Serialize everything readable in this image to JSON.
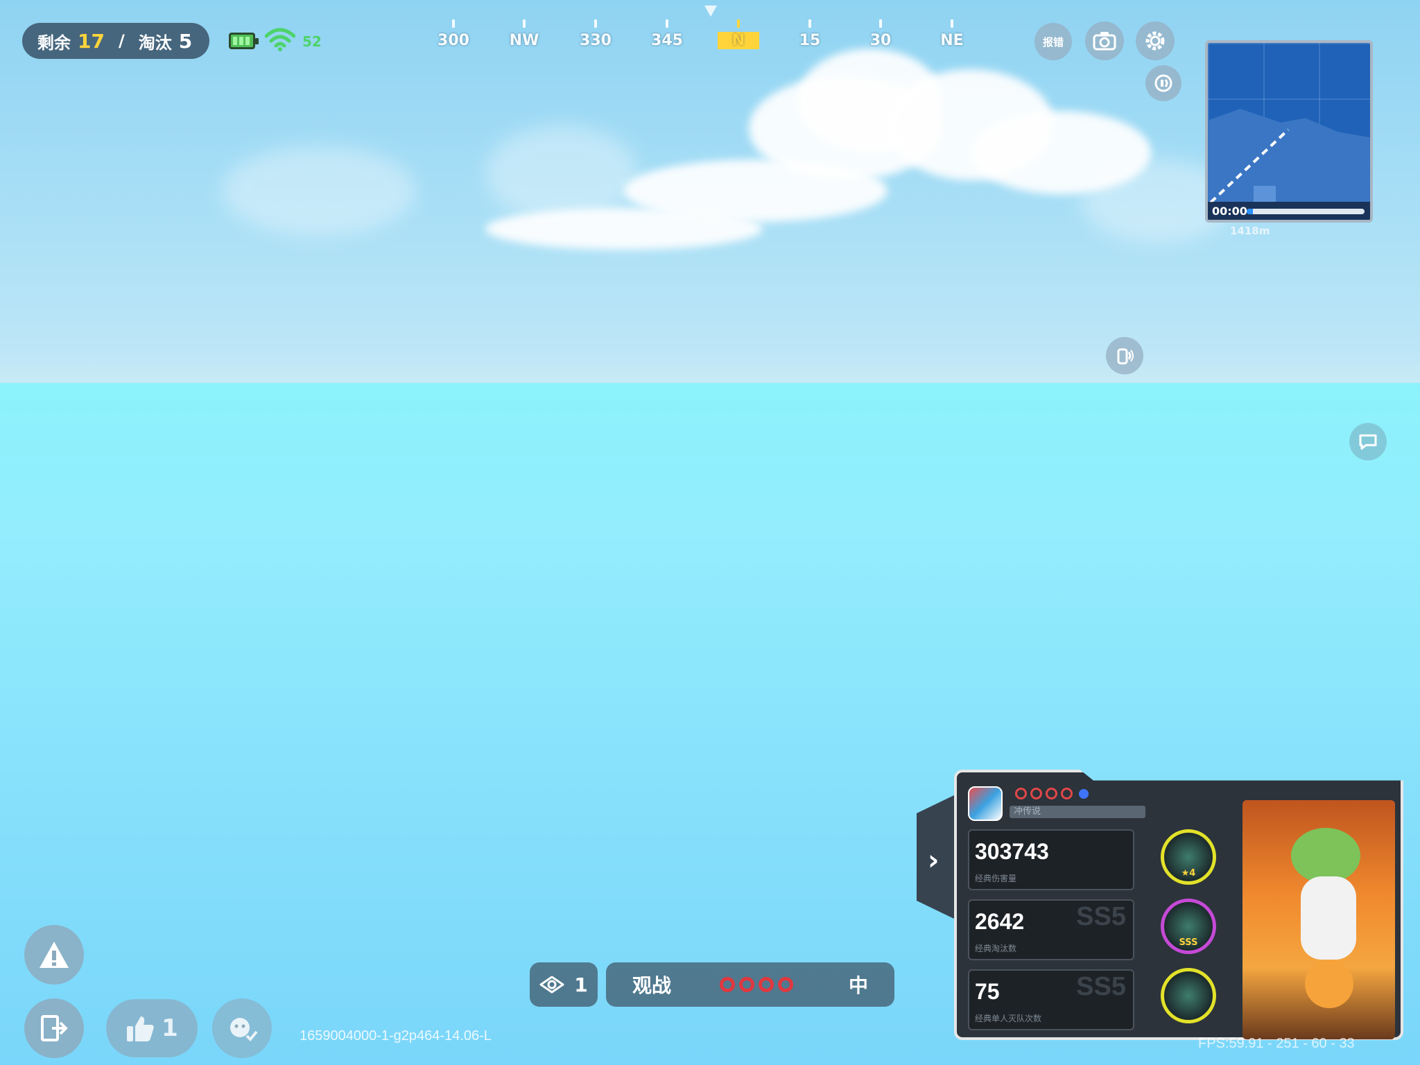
{
  "hud": {
    "remaining_label": "剩余",
    "remaining_count": "17",
    "separator": "/",
    "eliminated_label": "淘汰",
    "eliminated_count": "5",
    "ping": "52"
  },
  "compass": {
    "ticks": [
      "300",
      "NW",
      "330",
      "345",
      "N",
      "15",
      "30",
      "NE"
    ],
    "active": "N"
  },
  "top_right": {
    "report_label": "报错",
    "icons": [
      "camera-icon",
      "settings-gear-icon",
      "speaker-icon",
      "walkie-talkie-icon",
      "chat-bubble-icon"
    ]
  },
  "minimap": {
    "time": "00:00",
    "distance": "1418m",
    "progress": 0.05
  },
  "bottom_left": {
    "like_count": "1",
    "build_id": "1659004000-1-g2p464-14.06-L"
  },
  "spectate": {
    "viewer_count": "1",
    "label": "观战",
    "suffix": "中"
  },
  "player_card": {
    "rank_label": "冲传说",
    "stats": [
      {
        "value": "303743",
        "label": "经典伤害量",
        "grade": ""
      },
      {
        "value": "2642",
        "label": "经典淘汰数",
        "grade": "SS5"
      },
      {
        "value": "75",
        "label": "经典单人灭队次数",
        "grade": "SS5"
      }
    ],
    "medals": [
      {
        "label": "★4"
      },
      {
        "label": "SSS"
      },
      {
        "label": ""
      }
    ]
  },
  "fps_text": "FPS:59.91 - 251 - 60 - 33",
  "colors": {
    "accent_yellow": "#ffd43b",
    "ping_green": "#4ed36b",
    "ring_red": "#e0383f",
    "panel_dark": "#2c333b"
  }
}
